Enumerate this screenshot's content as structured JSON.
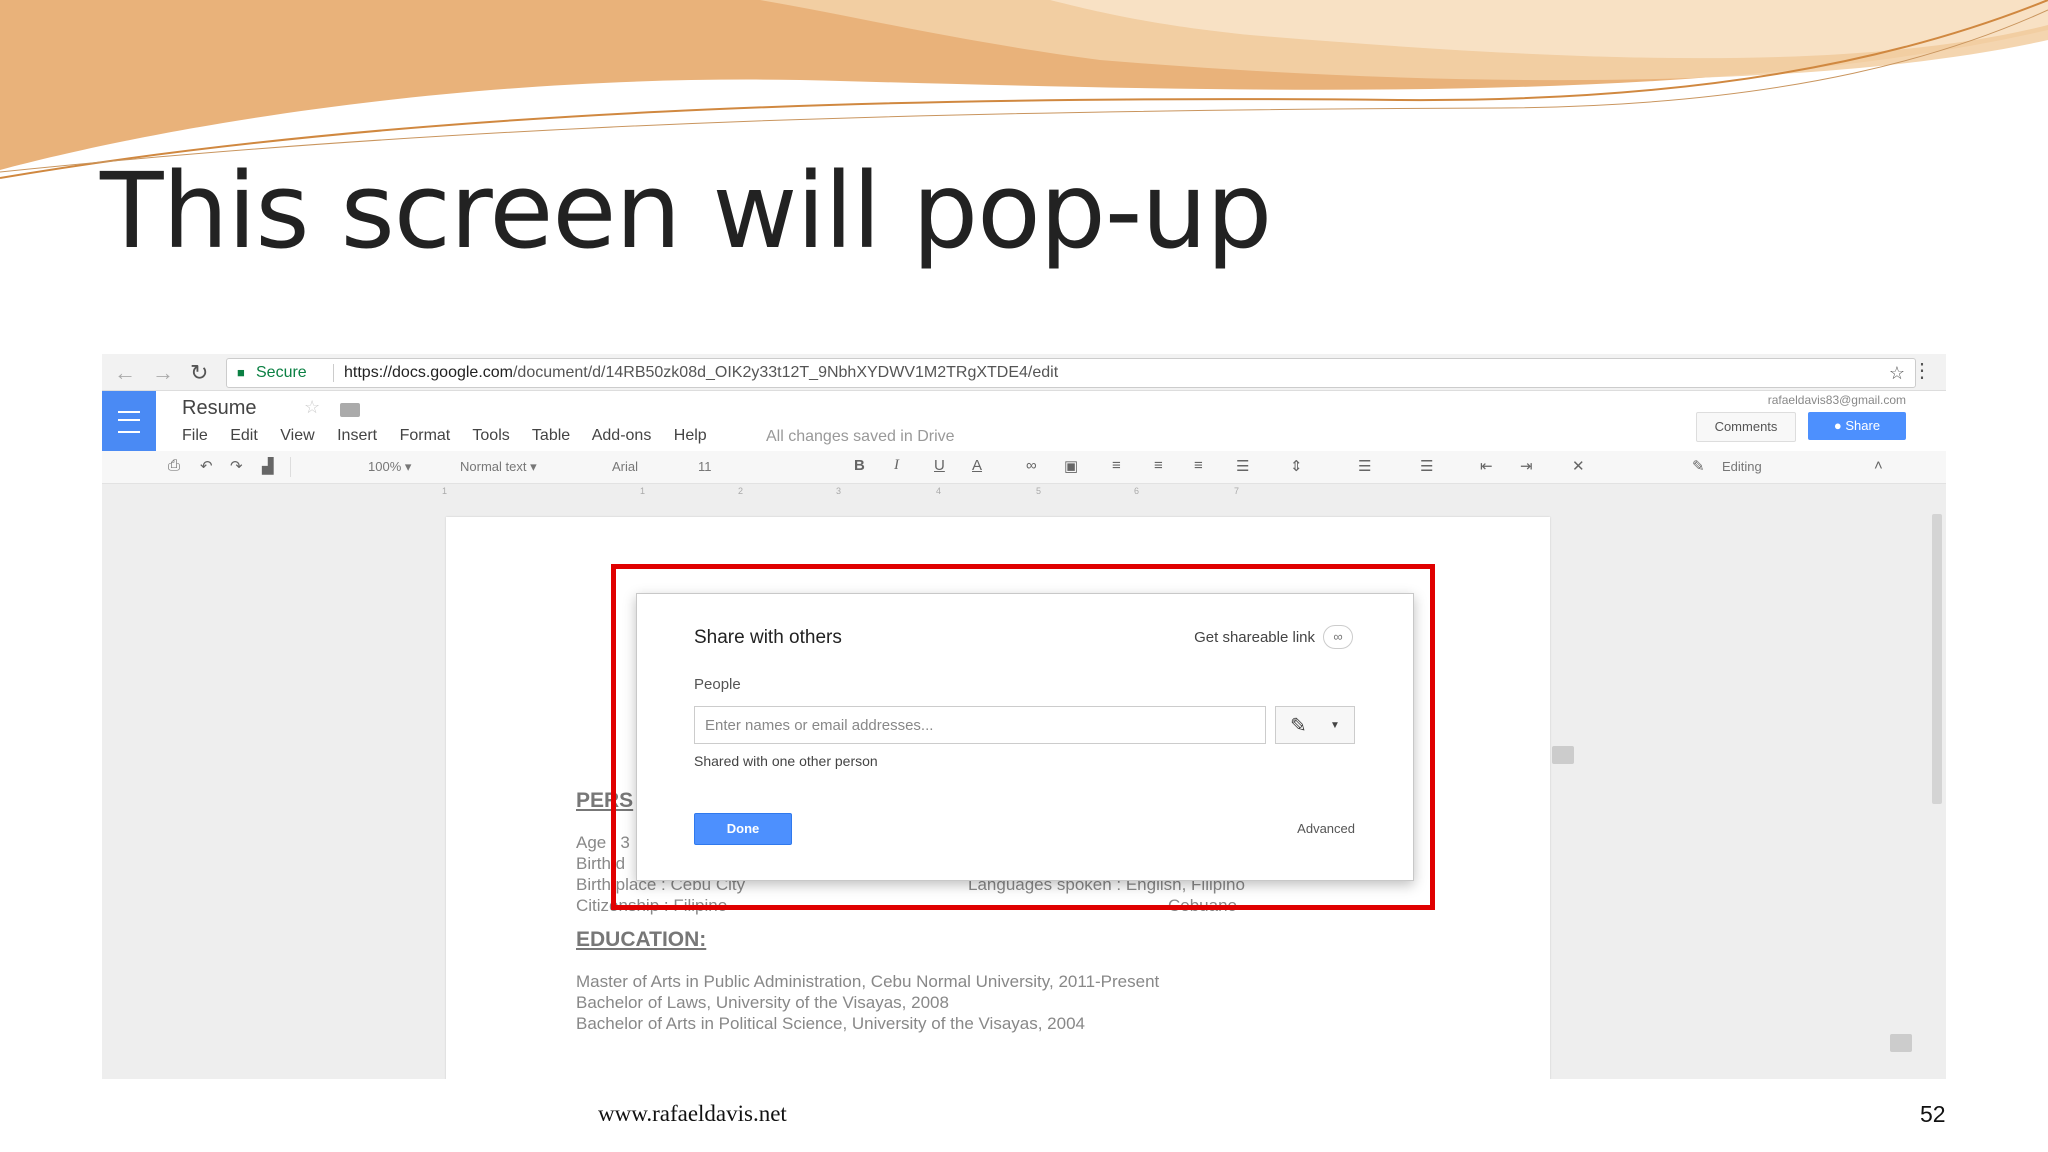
{
  "slide": {
    "title": "This screen will pop-up",
    "footer_site": "www.rafaeldavis.net",
    "page_number": "52"
  },
  "browser": {
    "secure_label": "Secure",
    "url_domain": "https://docs.google.com",
    "url_path": "/document/d/14RB50zk08d_OIK2y33t12T_9NbhXYDWV1M2TRgXTDE4/edit"
  },
  "docs": {
    "title": "Resume",
    "menu": [
      "File",
      "Edit",
      "View",
      "Insert",
      "Format",
      "Tools",
      "Table",
      "Add-ons",
      "Help"
    ],
    "saved_status": "All changes saved in Drive",
    "account": "rafaeldavis83@gmail.com",
    "comments_label": "Comments",
    "share_label": "Share"
  },
  "toolbar": {
    "zoom": "100%",
    "style": "Normal text",
    "font": "Arial",
    "size": "11",
    "mode": "Editing"
  },
  "ruler": [
    "1",
    "1",
    "2",
    "3",
    "4",
    "5",
    "6",
    "7"
  ],
  "document": {
    "section_personal": "PERS",
    "personal_lines": [
      "Age : 3",
      "Birth d",
      "Birth place : Cebu City",
      "Citizenship : Filipino"
    ],
    "languages": "Languages spoken : English, Filipino",
    "languages_cont": "Cebuano",
    "section_education": "EDUCATION:",
    "education": [
      "Master of Arts in Public Administration, Cebu Normal University, 2011-Present",
      "Bachelor of Laws, University of the Visayas, 2008",
      "Bachelor of Arts in Political Science, University of the Visayas, 2004"
    ]
  },
  "dialog": {
    "title": "Share with others",
    "shareable_link": "Get shareable link",
    "people_label": "People",
    "input_placeholder": "Enter names or email addresses...",
    "shared_note": "Shared with one other person",
    "done_label": "Done",
    "advanced_label": "Advanced"
  },
  "colors": {
    "highlight_border": "#e00000",
    "docs_blue": "#4a8af4",
    "button_blue": "#4d90fe",
    "swoosh_orange": "#e8a25a"
  }
}
